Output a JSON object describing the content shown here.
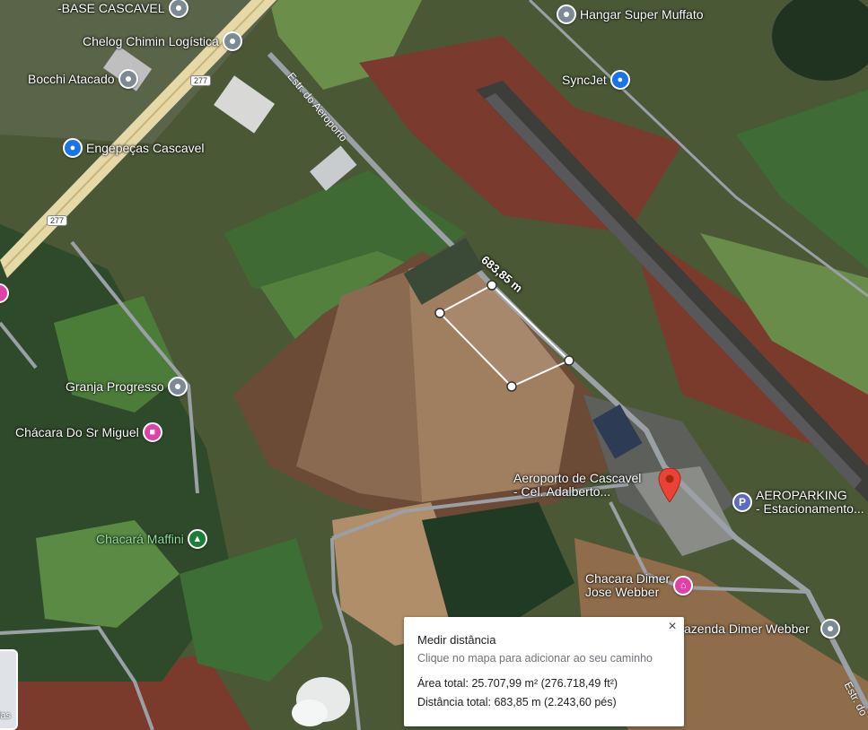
{
  "map": {
    "pois": [
      {
        "name": "poi-base-cascavel",
        "label_lines": [
          "-BASE CASCAVEL"
        ],
        "pin": "gray"
      },
      {
        "name": "poi-hangar-super-muffato",
        "label_lines": [
          "Hangar Super Muffato"
        ],
        "pin": "gray"
      },
      {
        "name": "poi-chelog",
        "label_lines": [
          "Chelog Chimin Logística"
        ],
        "pin": "gray"
      },
      {
        "name": "poi-bocchi",
        "label_lines": [
          "Bocchi Atacado"
        ],
        "pin": "gray"
      },
      {
        "name": "poi-syncjet",
        "label_lines": [
          "SyncJet"
        ],
        "pin": "blue"
      },
      {
        "name": "poi-engepecas",
        "label_lines": [
          "Engepeças Cascavel"
        ],
        "pin": "blue"
      },
      {
        "name": "poi-granja-progresso",
        "label_lines": [
          "Granja Progresso"
        ],
        "pin": "gray"
      },
      {
        "name": "poi-chacara-sr-miguel",
        "label_lines": [
          "Chácara Do Sr Miguel"
        ],
        "pin": "pink"
      },
      {
        "name": "poi-chacara-maffini",
        "label_lines": [
          "Chacará Maffini"
        ],
        "pin": "green"
      },
      {
        "name": "poi-aeroporto",
        "label_lines": [
          "Aeroporto de Cascavel",
          "- Cel. Adalberto..."
        ],
        "pin": "red"
      },
      {
        "name": "poi-aeroparking",
        "label_lines": [
          "AEROPARKING",
          "- Estacionamento..."
        ],
        "pin": "park"
      },
      {
        "name": "poi-chacara-dimer",
        "label_lines": [
          "Chacara Dimer",
          "Jose Webber"
        ],
        "pin": "pink"
      },
      {
        "name": "poi-fazenda-dimer",
        "label_lines": [
          "azenda Dimer Webber"
        ],
        "pin": "gray"
      }
    ],
    "roads": {
      "estr_aeroporto": "Estr. do Aeroporto",
      "estr_bottom": "Estr. do",
      "shield_277": "277"
    },
    "measure_label": "683,85 m",
    "layers_label": "las"
  },
  "panel": {
    "title": "Medir distância",
    "hint": "Clique no mapa para adicionar ao seu caminho",
    "area": "Área total: 25.707,99 m² (276.718,49 ft²)",
    "distance": "Distância total: 683,85 m (2.243,60 pés)",
    "close_icon": "×"
  },
  "colors": {
    "pin_red": "#ea4335",
    "measure_line": "#ffffff"
  }
}
